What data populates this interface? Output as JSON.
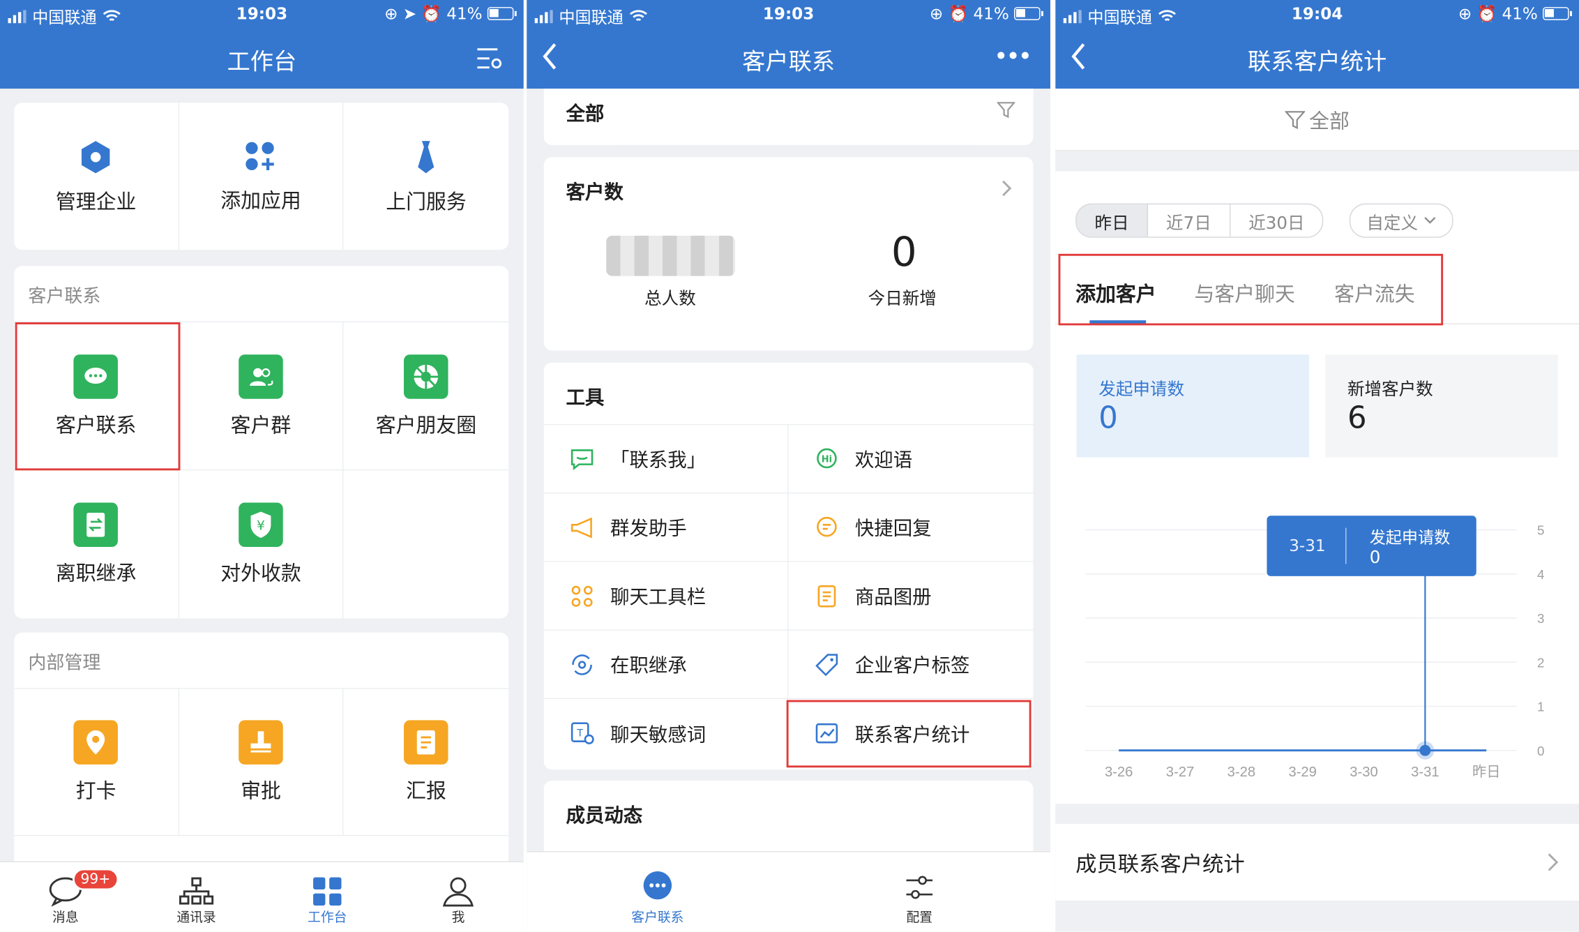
{
  "status_bar": [
    {
      "carrier": "中国联通",
      "time": "19:03",
      "battery": "41%"
    },
    {
      "carrier": "中国联通",
      "time": "19:03",
      "battery": "41%"
    },
    {
      "carrier": "中国联通",
      "time": "19:04",
      "battery": "41%"
    }
  ],
  "screen1": {
    "title": "工作台",
    "top_apps": [
      {
        "label": "管理企业",
        "icon": "hexagon-icon"
      },
      {
        "label": "添加应用",
        "icon": "add-apps-icon"
      },
      {
        "label": "上门服务",
        "icon": "tie-icon"
      }
    ],
    "section1": {
      "title": "客户联系",
      "items": [
        {
          "label": "客户联系",
          "icon": "chat-bubble-icon"
        },
        {
          "label": "客户群",
          "icon": "group-icon"
        },
        {
          "label": "客户朋友圈",
          "icon": "aperture-icon"
        },
        {
          "label": "离职继承",
          "icon": "transfer-icon"
        },
        {
          "label": "对外收款",
          "icon": "yuan-shield-icon"
        }
      ]
    },
    "section2": {
      "title": "内部管理",
      "items": [
        {
          "label": "打卡",
          "icon": "location-pin-icon"
        },
        {
          "label": "审批",
          "icon": "stamp-icon"
        },
        {
          "label": "汇报",
          "icon": "report-icon"
        }
      ]
    },
    "tabbar": [
      {
        "label": "消息",
        "badge": "99+"
      },
      {
        "label": "通讯录"
      },
      {
        "label": "工作台"
      },
      {
        "label": "我"
      }
    ],
    "colors": {
      "primary": "#3577cf",
      "green": "#2fb35d",
      "orange": "#f6a623",
      "highlight": "#e23a3a"
    }
  },
  "screen2": {
    "title": "客户联系",
    "filter_label": "全部",
    "customers_card": {
      "title": "客户数",
      "total_label": "总人数",
      "today_value": "0",
      "today_label": "今日新增"
    },
    "tools_title": "工具",
    "tools": [
      "「联系我」",
      "欢迎语",
      "群发助手",
      "快捷回复",
      "聊天工具栏",
      "商品图册",
      "在职继承",
      "企业客户标签",
      "聊天敏感词",
      "联系客户统计"
    ],
    "member_activity_title": "成员动态",
    "tabbar": [
      {
        "label": "客户联系"
      },
      {
        "label": "配置"
      }
    ]
  },
  "screen3": {
    "title": "联系客户统计",
    "filter_label": "全部",
    "ranges": [
      "昨日",
      "近7日",
      "近30日"
    ],
    "custom_label": "自定义",
    "tabs": [
      "添加客户",
      "与客户聊天",
      "客户流失"
    ],
    "stat_cards": [
      {
        "label": "发起申请数",
        "value": "0"
      },
      {
        "label": "新增客户数",
        "value": "6"
      }
    ],
    "tooltip": {
      "date": "3-31",
      "label": "发起申请数",
      "value": "0"
    },
    "member_stats_label": "成员联系客户统计",
    "chart_data": {
      "type": "line",
      "categories": [
        "3-26",
        "3-27",
        "3-28",
        "3-29",
        "3-30",
        "3-31",
        "昨日"
      ],
      "series": [
        {
          "name": "发起申请数",
          "values": [
            0,
            0,
            0,
            0,
            0,
            0,
            0
          ]
        }
      ],
      "ylim": [
        0,
        5
      ],
      "yticks": [
        "0",
        "1",
        "2",
        "3",
        "4",
        "5"
      ],
      "highlighted_index": 5
    }
  }
}
